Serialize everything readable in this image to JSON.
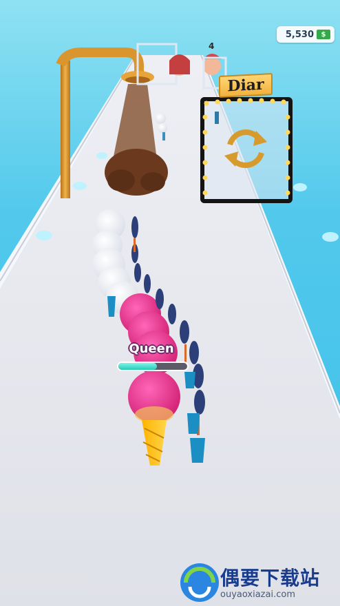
{
  "hud": {
    "money_amount": "5,530",
    "money_icon": "dollar-bill-icon",
    "money_bill_glyph": "$"
  },
  "gate": {
    "brand_label": "Diar",
    "icon": "refresh-arrows-icon"
  },
  "player": {
    "rank_label": "Queen",
    "rank_progress": 0.56
  },
  "rival": {
    "count": "4"
  },
  "watermark": {
    "title": "偶要下载站",
    "url": "ouyaoxiazai.com"
  },
  "colors": {
    "sky": "#52c9ec",
    "track": "#e5e7ee",
    "progress_fill": "#25cbb8",
    "money_bill": "#34a94a",
    "brand_sign": "#f2b23f",
    "pink_scoop": "#e8358a",
    "brown_spray": "#6b3a1e"
  }
}
